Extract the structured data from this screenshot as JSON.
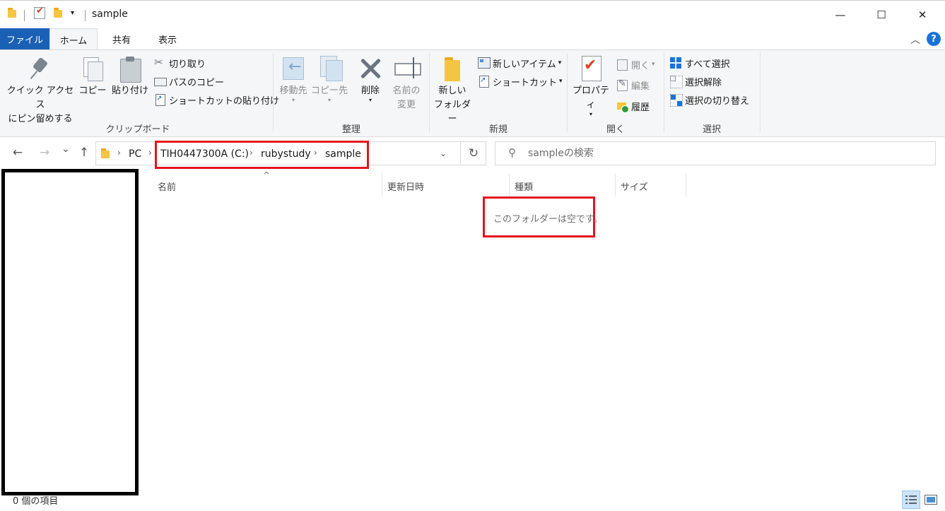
{
  "window": {
    "title": "sample",
    "minimize_glyph": "—",
    "maximize_glyph": "☐",
    "close_glyph": "✕"
  },
  "tabs": {
    "file": "ファイル",
    "home": "ホーム",
    "share": "共有",
    "view": "表示",
    "help_glyph": "?"
  },
  "ribbon": {
    "clipboard": {
      "title": "クリップボード",
      "pin_line1": "クイック アクセス",
      "pin_line2": "にピン留めする",
      "copy": "コピー",
      "paste": "貼り付け",
      "cut": "切り取り",
      "copy_path": "パスのコピー",
      "paste_shortcut": "ショートカットの貼り付け"
    },
    "organize": {
      "title": "整理",
      "move_to": "移動先",
      "copy_to": "コピー先",
      "delete": "削除",
      "rename_line1": "名前の",
      "rename_line2": "変更"
    },
    "new": {
      "title": "新規",
      "new_folder_line1": "新しい",
      "new_folder_line2": "フォルダー",
      "new_item": "新しいアイテム",
      "easy_access": "ショートカット"
    },
    "open": {
      "title": "開く",
      "properties": "プロパティ",
      "open": "開く",
      "edit": "編集",
      "history": "履歴"
    },
    "select": {
      "title": "選択",
      "select_all": "すべて選択",
      "select_none": "選択解除",
      "invert": "選択の切り替え"
    }
  },
  "nav": {
    "back_glyph": "←",
    "forward_glyph": "→",
    "recent_glyph": "⌄",
    "up_glyph": "↑",
    "breadcrumb": [
      "PC",
      "TIH0447300A (C:)",
      "rubystudy",
      "sample"
    ],
    "crumb_sep": "›",
    "refresh_glyph": "↻",
    "search_placeholder": "sampleの検索"
  },
  "columns": {
    "name": "名前",
    "modified": "更新日時",
    "type": "種類",
    "size": "サイズ"
  },
  "content": {
    "empty_message": "このフォルダーは空です。"
  },
  "status": {
    "item_count": "0 個の項目"
  },
  "colors": {
    "file_tab": "#1a61b5",
    "highlight_box": "#e2141f",
    "ribbon_bg": "#f5f6f7"
  }
}
